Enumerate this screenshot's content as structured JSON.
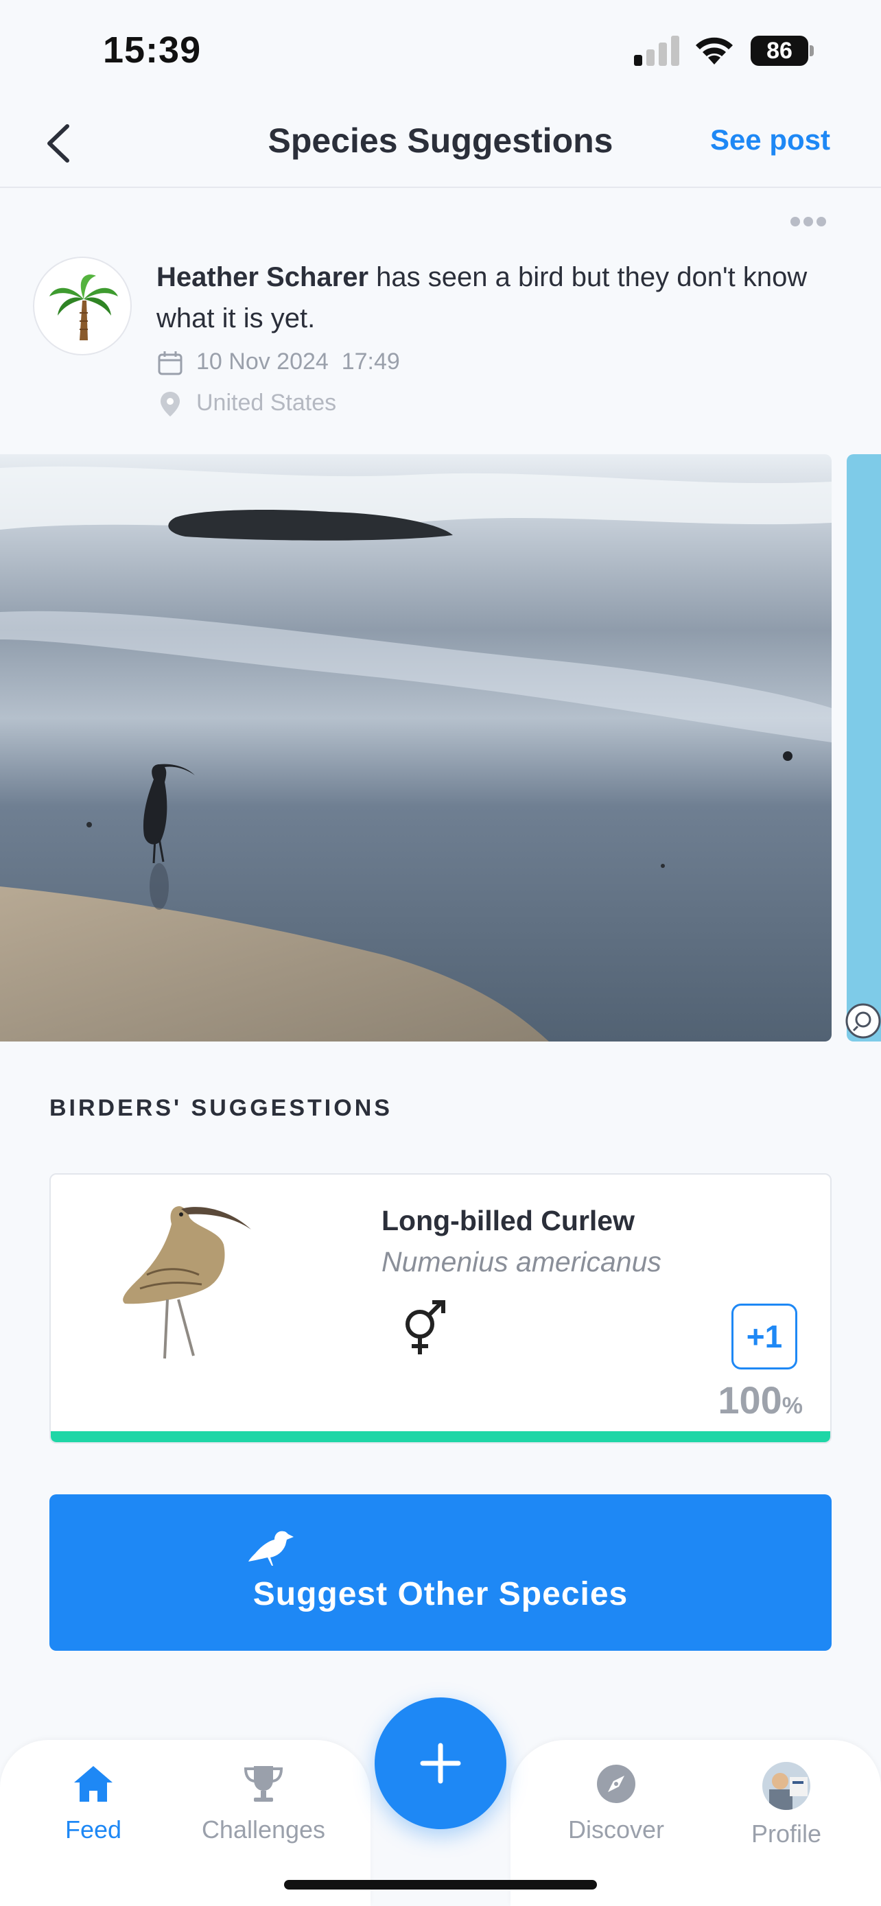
{
  "status_bar": {
    "time": "15:39",
    "battery": "86"
  },
  "header": {
    "title": "Species Suggestions",
    "see_post": "See post"
  },
  "post": {
    "author": "Heather Scharer",
    "text": " has seen a bird but they don't know what it is yet.",
    "date": "10 Nov 2024",
    "time": "17:49",
    "location": "United States"
  },
  "suggestions": {
    "section_title": "BIRDERS' SUGGESTIONS",
    "items": [
      {
        "common_name": "Long-billed Curlew",
        "latin_name": "Numenius americanus",
        "vote_label": "+1",
        "percent_value": "100",
        "percent_symbol": "%",
        "percent_fraction": 1.0
      }
    ]
  },
  "suggest_button": {
    "label": "Suggest Other Species"
  },
  "tabbar": {
    "feed": "Feed",
    "challenges": "Challenges",
    "discover": "Discover",
    "profile": "Profile"
  },
  "colors": {
    "accent": "#1e88f5",
    "progress": "#1ed6a6"
  }
}
